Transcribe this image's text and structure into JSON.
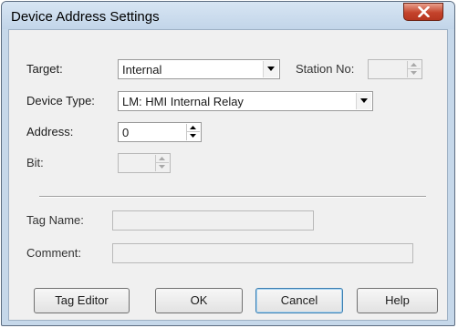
{
  "window": {
    "title": "Device Address Settings"
  },
  "form": {
    "target": {
      "label": "Target:",
      "value": "Internal"
    },
    "station_no": {
      "label": "Station No:",
      "value": ""
    },
    "device_type": {
      "label": "Device Type:",
      "value": "LM: HMI Internal Relay"
    },
    "address": {
      "label": "Address:",
      "value": "0"
    },
    "bit": {
      "label": "Bit:",
      "value": ""
    },
    "tag_name": {
      "label": "Tag Name:",
      "value": ""
    },
    "comment": {
      "label": "Comment:",
      "value": ""
    }
  },
  "buttons": {
    "tag_editor": "Tag Editor",
    "ok": "OK",
    "cancel": "Cancel",
    "help": "Help"
  },
  "icons": {
    "close": "close-icon",
    "dropdown": "chevron-down-icon",
    "spin_up": "arrow-up-icon",
    "spin_down": "arrow-down-icon"
  },
  "colors": {
    "title_bar": "#c6d8ea",
    "client_bg": "#f0f0f0",
    "close_button": "#c4432b",
    "default_button_border": "#3c7fb1"
  }
}
